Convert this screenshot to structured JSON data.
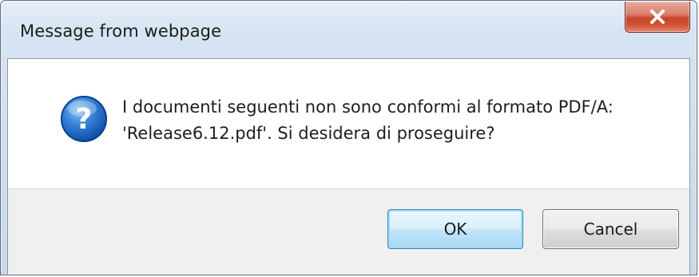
{
  "dialog": {
    "title": "Message from webpage",
    "icon": "question-icon",
    "message_line1": "I documenti seguenti non sono conformi al formato PDF/A:",
    "message_line2": "'Release6.12.pdf'. Si desidera di proseguire?",
    "ok_label": "OK",
    "cancel_label": "Cancel",
    "close_icon": "close-icon",
    "colors": {
      "close_button": "#c7442a",
      "ok_border": "#3c7fb1",
      "icon_blue": "#1f5fb8"
    }
  }
}
